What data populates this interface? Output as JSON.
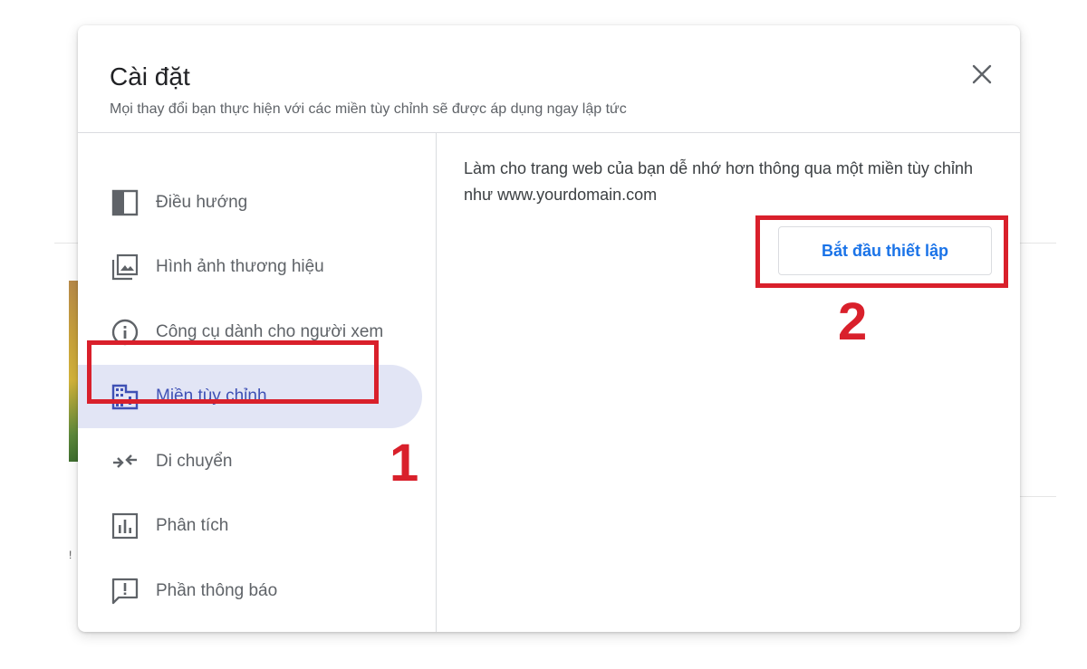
{
  "dialog": {
    "title": "Cài đặt",
    "subtitle": "Mọi thay đổi bạn thực hiện với các miền tùy chỉnh sẽ được áp dụng ngay lập tức"
  },
  "sidebar": {
    "items": [
      {
        "label": "Điều hướng",
        "icon": "navigation-panel-icon",
        "active": false
      },
      {
        "label": "Hình ảnh thương hiệu",
        "icon": "branding-images-icon",
        "active": false
      },
      {
        "label": "Công cụ dành cho người xem",
        "icon": "info-circle-icon",
        "active": false
      },
      {
        "label": "Miền tùy chỉnh",
        "icon": "building-domain-icon",
        "active": true
      },
      {
        "label": "Di chuyển",
        "icon": "merge-arrows-icon",
        "active": false
      },
      {
        "label": "Phân tích",
        "icon": "analytics-chart-icon",
        "active": false
      },
      {
        "label": "Phần thông báo",
        "icon": "announcement-icon",
        "active": false
      }
    ]
  },
  "content": {
    "description": "Làm cho trang web của bạn dễ nhớ hơn thông qua một miền tùy chỉnh như www.yourdomain.com",
    "setup_button": "Bắt đầu thiết lập"
  },
  "annotations": {
    "step1": "1",
    "step2": "2"
  },
  "colors": {
    "accent": "#3f51b5",
    "button_text": "#1a73e8",
    "active_bg": "#e2e5f5",
    "annotation": "#d9202b"
  }
}
